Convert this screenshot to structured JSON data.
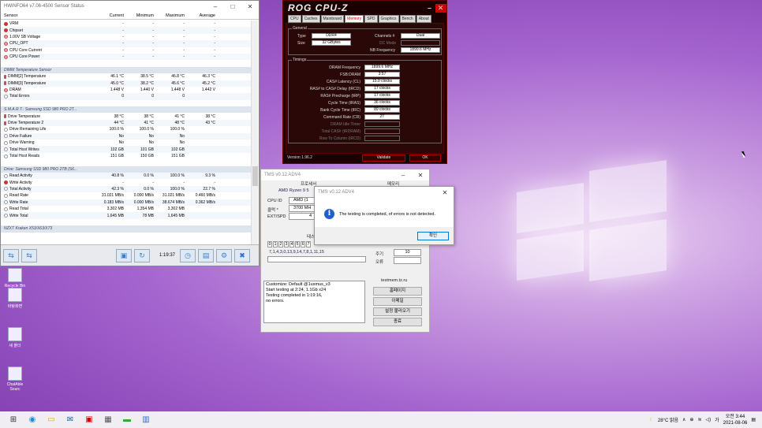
{
  "hwinfo": {
    "title": "HWiNFO64 v7.06-4500 Sensor Status",
    "columns": [
      "Sensor",
      "Current",
      "Minimum",
      "Maximum",
      "Average"
    ],
    "rows": [
      {
        "kind": "item",
        "icon": "red",
        "name": "VRM",
        "cur": "-",
        "min": "-",
        "max": "-",
        "avg": "-"
      },
      {
        "kind": "item",
        "icon": "red",
        "name": "Chipset",
        "cur": "-",
        "min": "-",
        "max": "-",
        "avg": "-"
      },
      {
        "kind": "item",
        "icon": "warn",
        "name": "1.00V SB Voltage",
        "cur": "-",
        "min": "-",
        "max": "-",
        "avg": "-"
      },
      {
        "kind": "item",
        "icon": "warn",
        "name": "CPU_OPT",
        "cur": "-",
        "min": "-",
        "max": "-",
        "avg": "-"
      },
      {
        "kind": "item",
        "icon": "warn",
        "name": "CPU Core Current",
        "cur": "-",
        "min": "-",
        "max": "-",
        "avg": "-"
      },
      {
        "kind": "item",
        "icon": "warn",
        "name": "CPU Core Power",
        "cur": "-",
        "min": "-",
        "max": "-",
        "avg": "-"
      },
      {
        "kind": "blank",
        "name": "",
        "cur": "",
        "min": "",
        "max": "",
        "avg": ""
      },
      {
        "kind": "group",
        "name": "DIMM Temperature Sensor",
        "cur": "",
        "min": "",
        "max": "",
        "avg": ""
      },
      {
        "kind": "item",
        "icon": "therm",
        "name": "DIMM[2] Temperature",
        "cur": "46.1 °C",
        "min": "38.5 °C",
        "max": "46.8 °C",
        "avg": "46.3 °C"
      },
      {
        "kind": "item",
        "icon": "therm",
        "name": "DIMM[3] Temperature",
        "cur": "45.0 °C",
        "min": "38.2 °C",
        "max": "45.6 °C",
        "avg": "45.2 °C"
      },
      {
        "kind": "item",
        "icon": "warn",
        "name": "DRAM",
        "cur": "1.448 V",
        "min": "1.440 V",
        "max": "1.448 V",
        "avg": "1.442 V"
      },
      {
        "kind": "item",
        "icon": "ring",
        "name": "Total Errors",
        "cur": "0",
        "min": "0",
        "max": "0",
        "avg": ""
      },
      {
        "kind": "blank",
        "name": "",
        "cur": "",
        "min": "",
        "max": "",
        "avg": ""
      },
      {
        "kind": "group",
        "name": "S.M.A.R.T.: Samsung SSD 980 PRO 2T...",
        "cur": "",
        "min": "",
        "max": "",
        "avg": ""
      },
      {
        "kind": "item",
        "icon": "therm",
        "name": "Drive Temperature",
        "cur": "38 °C",
        "min": "38 °C",
        "max": "41 °C",
        "avg": "38 °C"
      },
      {
        "kind": "item",
        "icon": "therm",
        "name": "Drive Temperature 2",
        "cur": "44 °C",
        "min": "41 °C",
        "max": "48 °C",
        "avg": "43 °C"
      },
      {
        "kind": "item",
        "icon": "ring",
        "name": "Drive Remaining Life",
        "cur": "100.0 %",
        "min": "100.0 %",
        "max": "100.0 %",
        "avg": ""
      },
      {
        "kind": "item",
        "icon": "ring",
        "name": "Drive Failure",
        "cur": "No",
        "min": "No",
        "max": "No",
        "avg": ""
      },
      {
        "kind": "item",
        "icon": "ring",
        "name": "Drive Warning",
        "cur": "No",
        "min": "No",
        "max": "No",
        "avg": ""
      },
      {
        "kind": "item",
        "icon": "ring",
        "name": "Total Host Writes",
        "cur": "102 GB",
        "min": "101 GB",
        "max": "102 GB",
        "avg": ""
      },
      {
        "kind": "item",
        "icon": "ring",
        "name": "Total Host Reads",
        "cur": "151 GB",
        "min": "150 GB",
        "max": "151 GB",
        "avg": ""
      },
      {
        "kind": "blank",
        "name": "",
        "cur": "",
        "min": "",
        "max": "",
        "avg": ""
      },
      {
        "kind": "group",
        "name": "Drive: Samsung SSD 980 PRO 2TB (S6...",
        "cur": "",
        "min": "",
        "max": "",
        "avg": ""
      },
      {
        "kind": "item",
        "icon": "ring",
        "name": "Read Activity",
        "cur": "40.8 %",
        "min": "0.0 %",
        "max": "100.0 %",
        "avg": "9.3 %"
      },
      {
        "kind": "item",
        "icon": "red",
        "name": "Write Activity",
        "cur": "-",
        "min": "-",
        "max": "-",
        "avg": "-"
      },
      {
        "kind": "item",
        "icon": "ring",
        "name": "Total Activity",
        "cur": "42.3 %",
        "min": "0.0 %",
        "max": "100.0 %",
        "avg": "22.7 %"
      },
      {
        "kind": "item",
        "icon": "ring",
        "name": "Read Rate",
        "cur": "31.021 MB/s",
        "min": "0.000 MB/s",
        "max": "31.021 MB/s",
        "avg": "0.460 MB/s"
      },
      {
        "kind": "item",
        "icon": "ring",
        "name": "Write Rate",
        "cur": "0.183 MB/s",
        "min": "0.000 MB/s",
        "max": "38.674 MB/s",
        "avg": "0.362 MB/s"
      },
      {
        "kind": "item",
        "icon": "ring",
        "name": "Read Total",
        "cur": "3,302 MB",
        "min": "1,354 MB",
        "max": "3,302 MB",
        "avg": ""
      },
      {
        "kind": "item",
        "icon": "ring",
        "name": "Write Total",
        "cur": "1,645 MB",
        "min": "78 MB",
        "max": "1,645 MB",
        "avg": ""
      },
      {
        "kind": "blank",
        "name": "",
        "cur": "",
        "min": "",
        "max": "",
        "avg": ""
      },
      {
        "kind": "group",
        "name": "NZXT Kraken X53/X63/X73",
        "cur": "",
        "min": "",
        "max": "",
        "avg": ""
      }
    ],
    "elapsed": "1:19:37"
  },
  "cpuz": {
    "title": "ROG CPU-Z",
    "tabs": [
      "CPU",
      "Caches",
      "Mainboard",
      "Memory",
      "SPD",
      "Graphics",
      "Bench",
      "About"
    ],
    "active_tab": "Memory",
    "general_legend": "General",
    "type_label": "Type",
    "type": "DDR4",
    "size_label": "Size",
    "size": "32 GBytes",
    "channels_label": "Channels #",
    "channels": "Dual",
    "dc_mode_label": "DC Mode",
    "nb_freq_label": "NB Frequency",
    "nb_freq": "1899.6 MHz",
    "timings_legend": "Timings",
    "timings": [
      {
        "label": "DRAM Frequency",
        "value": "1899.6 MHz"
      },
      {
        "label": "FSB:DRAM",
        "value": "3:57"
      },
      {
        "label": "CAS# Latency (CL)",
        "value": "15.0 clocks"
      },
      {
        "label": "RAS# to CAS# Delay (tRCD)",
        "value": "17 clocks"
      },
      {
        "label": "RAS# Precharge (tRP)",
        "value": "17 clocks"
      },
      {
        "label": "Cycle Time (tRAS)",
        "value": "36 clocks"
      },
      {
        "label": "Bank Cycle Time (tRC)",
        "value": "89 clocks"
      },
      {
        "label": "Command Rate (CR)",
        "value": "2T"
      },
      {
        "label": "DRAM Idle Timer",
        "value": ""
      },
      {
        "label": "Total CAS# (tRDRAM)",
        "value": ""
      },
      {
        "label": "Row To Column (tRCD)",
        "value": ""
      }
    ],
    "version": "Version 1.96.2",
    "validate": "Validate",
    "ok": "OK"
  },
  "tms": {
    "title": "TMS v0.12 ADV4",
    "processor_tab": "프로세서",
    "memory_tab": "메모리",
    "cpu_name": "AMD Ryzen 9 5",
    "cpu_id_label": "CPU ID",
    "cpu_id": "AMD (1",
    "clock_label": "클럭 *",
    "clock": "3700 MH",
    "ext_label": "EXT/SPD",
    "ext": "4",
    "test_label": "테스",
    "tests_digits": [
      "0",
      "1",
      "2",
      "3",
      "4",
      "5",
      "6",
      "7"
    ],
    "test_seq": "7,1,4,3,0,13,9,14,7,8,1,11,15",
    "cycle_label": "주기",
    "cycle": "10",
    "errors_label": "오류",
    "log": [
      "Customize: Default @1usmus_v3",
      "Start testing at 2:24, 1.1Gb x24",
      "Testing completed in 1:19:16,",
      "no errors."
    ],
    "site": "testmem.tz.ru",
    "btn_home": "홈페이지",
    "btn_email": "이메일",
    "btn_load": "설정 불러오기",
    "btn_exit": "종료"
  },
  "dialog": {
    "title": "TMS v0.12 ADV4",
    "message": "The testing is completed, of errors is not detected.",
    "ok": "확인"
  },
  "desktop_icons": [
    {
      "label": "Recycle Bin"
    },
    {
      "label": "바탕화면"
    },
    {
      "label": "새 폴더"
    },
    {
      "label": "ChatAble Sourc"
    }
  ],
  "taskbar": {
    "weather": "28°C 맑음",
    "lang": "가",
    "time": "오전 3:44",
    "date": "2021-08-06"
  }
}
